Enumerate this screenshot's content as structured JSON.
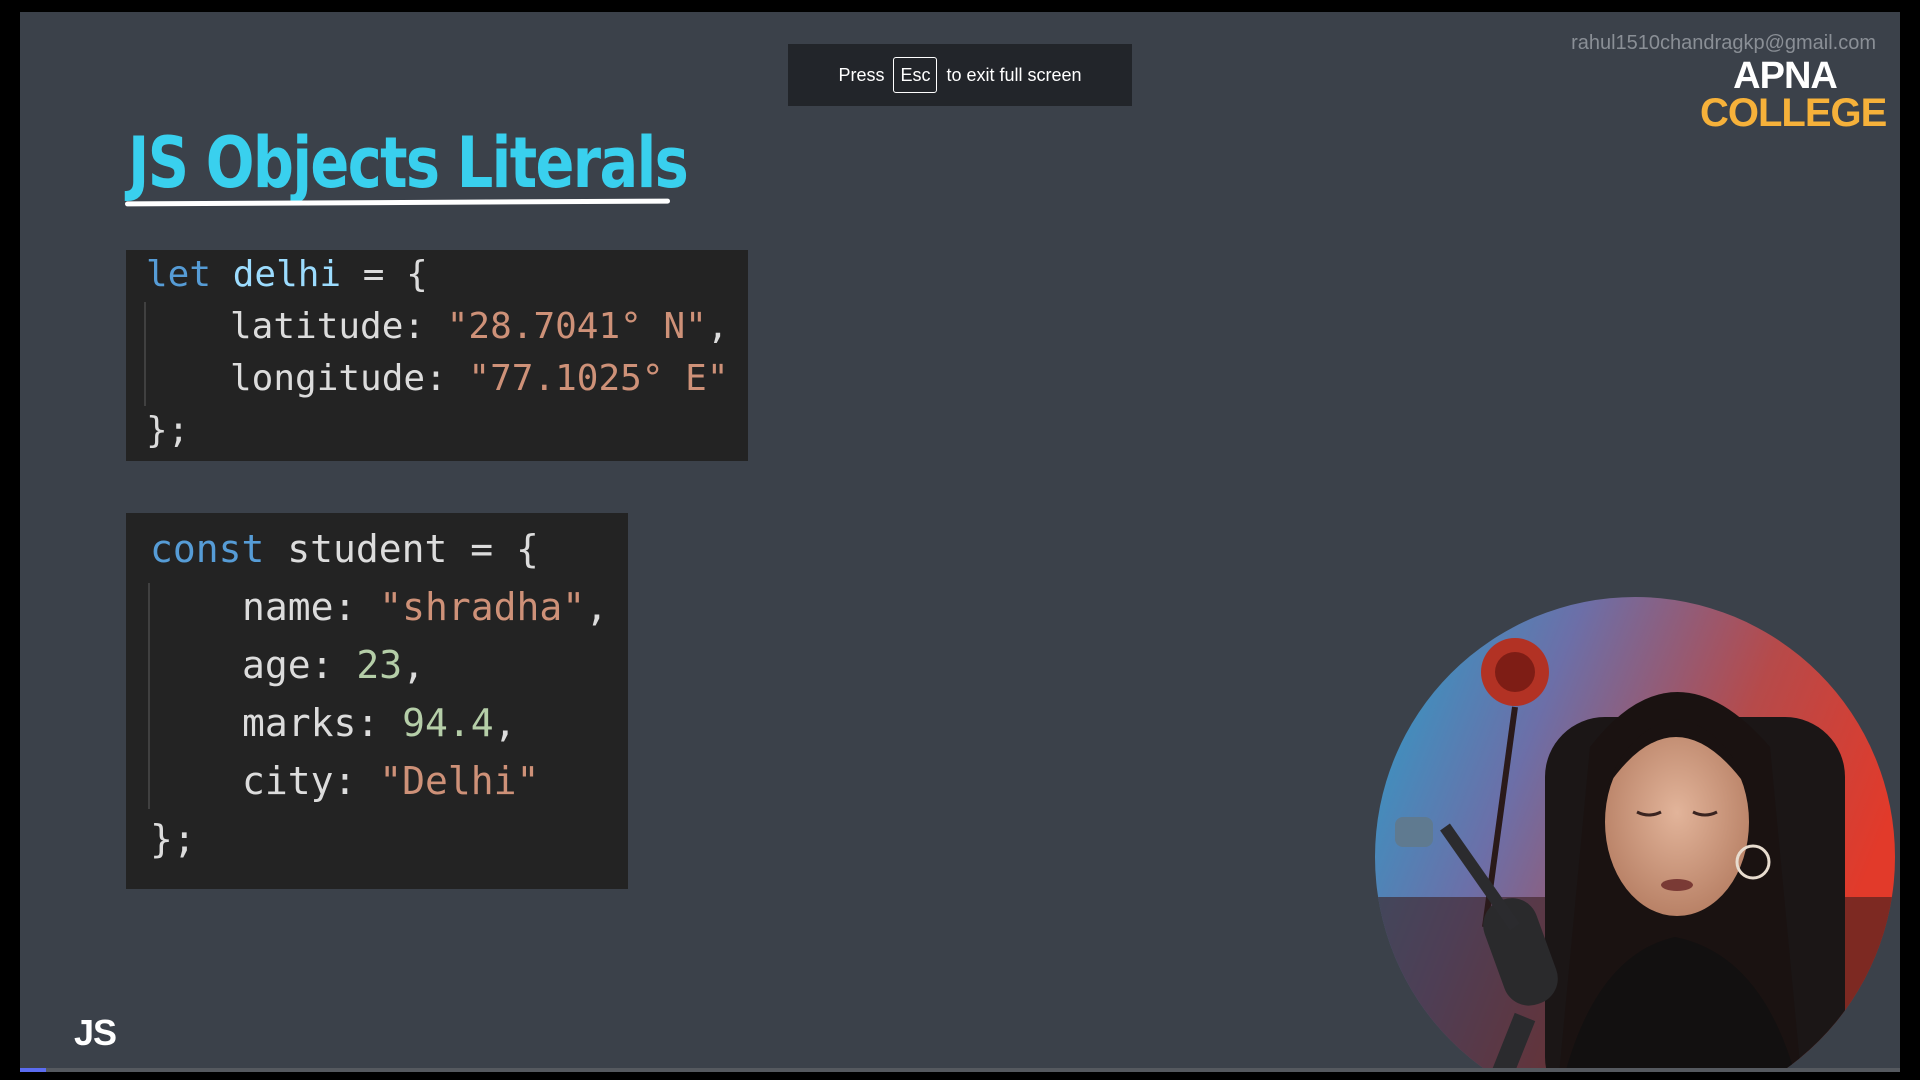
{
  "overlay": {
    "press_label": "Press",
    "key_label": "Esc",
    "exit_label": "to exit full screen"
  },
  "watermark": {
    "email": "rahul1510chandragkp@gmail.com"
  },
  "brand": {
    "line1": "APNA",
    "line2": "COLLEGE"
  },
  "slide": {
    "title": "JS Objects Literals",
    "corner_label": "JS",
    "code1": {
      "l1_kw": "let",
      "l1_name": "delhi",
      "l1_rest": " = {",
      "l2_key": "latitude: ",
      "l2_val": "\"28.7041° N\"",
      "l2_end": ",",
      "l3_key": "longitude: ",
      "l3_val": "\"77.1025° E\"",
      "l4": "};"
    },
    "code2": {
      "l1_kw": "const",
      "l1_rest": " student = {",
      "l2_key": "name: ",
      "l2_val": "\"shradha\"",
      "l2_end": ",",
      "l3_key": "age: ",
      "l3_val": "23",
      "l3_end": ",",
      "l4_key": "marks: ",
      "l4_val": "94.4",
      "l4_end": ",",
      "l5_key": "city: ",
      "l5_val": "\"Delhi\"",
      "l6": "};"
    }
  },
  "player": {
    "progress_fraction": 0.014
  },
  "colors": {
    "slide_bg": "#3b414a",
    "title": "#39d0ee",
    "code_bg": "#232323",
    "keyword": "#569cd6",
    "string": "#ce9178",
    "number": "#b5cea8",
    "brand_accent": "#f6b13a",
    "progress": "#5b6cf0"
  }
}
